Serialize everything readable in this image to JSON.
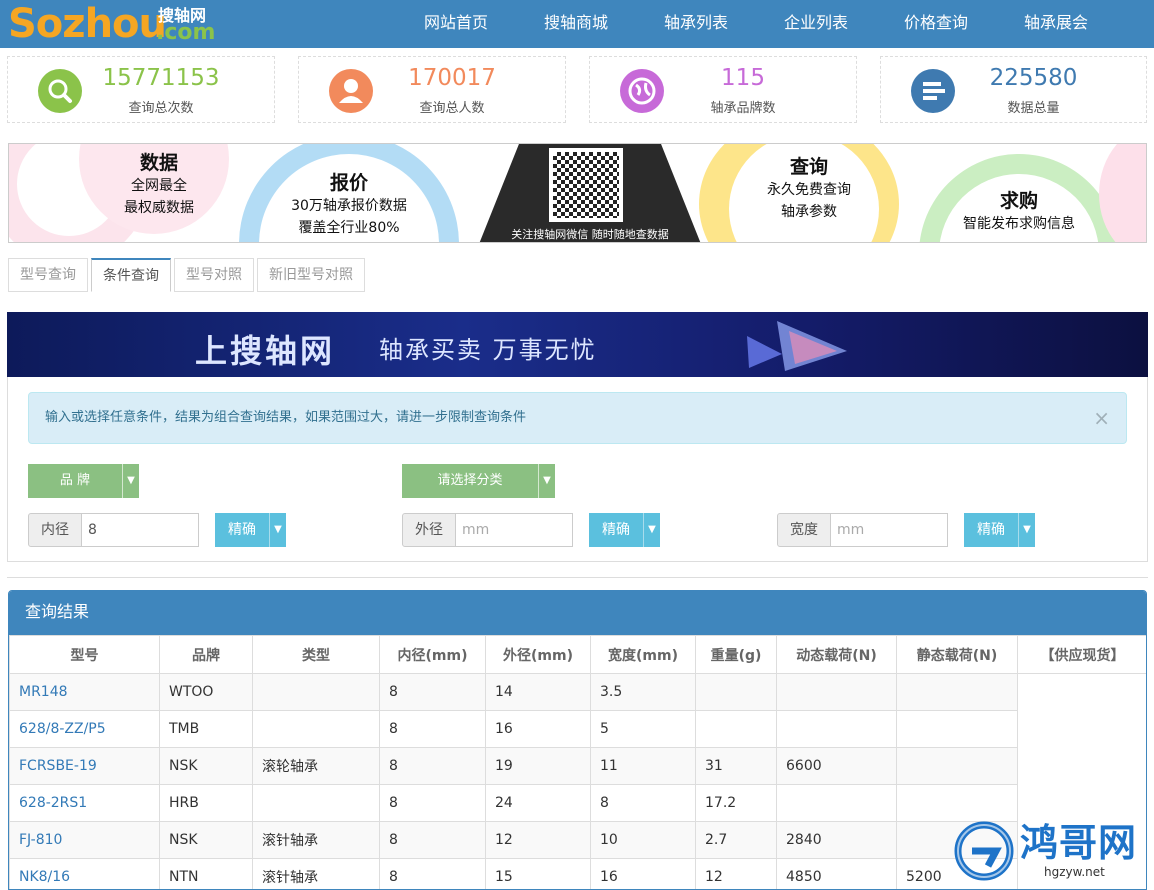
{
  "logo": {
    "brand": "Sozhou",
    "suffix": ".com",
    "cn": "搜轴网"
  },
  "nav": [
    "网站首页",
    "搜轴商城",
    "轴承列表",
    "企业列表",
    "价格查询",
    "轴承展会"
  ],
  "stats": [
    {
      "value": "15771153",
      "label": "查询总次数",
      "color": "#8bc34a",
      "icon": "search-icon"
    },
    {
      "value": "170017",
      "label": "查询总人数",
      "color": "#f28a5c",
      "icon": "user-icon"
    },
    {
      "value": "115",
      "label": "轴承品牌数",
      "color": "#c76ad8",
      "icon": "globe-icon"
    },
    {
      "value": "225580",
      "label": "数据总量",
      "color": "#3f7ab0",
      "icon": "list-icon"
    }
  ],
  "banner": {
    "b1": {
      "title": "数据",
      "l1": "全网最全",
      "l2": "最权威数据"
    },
    "b2": {
      "title": "报价",
      "l1": "30万轴承报价数据",
      "l2": "覆盖全行业80%"
    },
    "qr": "关注搜轴网微信 随时随地查数据",
    "b3": {
      "title": "查询",
      "l1": "永久免费查询",
      "l2": "轴承参数"
    },
    "b4": {
      "title": "求购",
      "l1": "智能发布求购信息"
    }
  },
  "tabs": [
    "型号查询",
    "条件查询",
    "型号对照",
    "新旧型号对照"
  ],
  "ad": {
    "t1": "上搜轴网",
    "t2": "轴承买卖  万事无忧"
  },
  "form": {
    "alert": "输入或选择任意条件，结果为组合查询结果，如果范围过大，请进一步限制查询条件",
    "brand_btn": "品 牌",
    "category_btn": "请选择分类",
    "inner": {
      "label": "内径",
      "value": "8"
    },
    "outer": {
      "label": "外径",
      "placeholder": "mm"
    },
    "width": {
      "label": "宽度",
      "placeholder": "mm"
    },
    "exact": "精确"
  },
  "results": {
    "title": "查询结果",
    "headers": [
      "型号",
      "品牌",
      "类型",
      "内径(mm)",
      "外径(mm)",
      "宽度(mm)",
      "重量(g)",
      "动态载荷(N)",
      "静态载荷(N)",
      "【供应现货】"
    ],
    "rows": [
      [
        "MR148",
        "WTOO",
        "",
        "8",
        "14",
        "3.5",
        "",
        "",
        ""
      ],
      [
        "628/8-ZZ/P5",
        "TMB",
        "",
        "8",
        "16",
        "5",
        "",
        "",
        ""
      ],
      [
        "FCRSBE-19",
        "NSK",
        "滚轮轴承",
        "8",
        "19",
        "11",
        "31",
        "6600",
        ""
      ],
      [
        "628-2RS1",
        "HRB",
        "",
        "8",
        "24",
        "8",
        "17.2",
        "",
        ""
      ],
      [
        "FJ-810",
        "NSK",
        "滚针轴承",
        "8",
        "12",
        "10",
        "2.7",
        "2840",
        ""
      ],
      [
        "NK8/16",
        "NTN",
        "滚针轴承",
        "8",
        "15",
        "16",
        "12",
        "4850",
        "5200"
      ]
    ]
  },
  "watermark": {
    "name": "鸿哥网",
    "url": "hgzyw.net"
  }
}
